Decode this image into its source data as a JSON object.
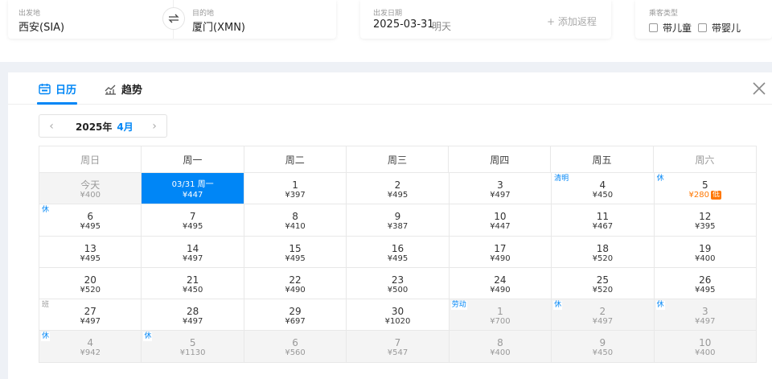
{
  "search": {
    "from_label": "出发地",
    "from_value": "西安(SIA)",
    "to_label": "目的地",
    "to_value": "厦门(XMN)",
    "date_label": "出发日期",
    "date_value": "2025-03-31",
    "day_note": "明天",
    "add_return": "+ 添加返程",
    "pax_label": "乘客类型",
    "pax_child": "带儿童",
    "pax_infant": "带婴儿"
  },
  "tabs": {
    "calendar": "日历",
    "trend": "趋势"
  },
  "month_nav": {
    "prev": "‹",
    "next": "›",
    "year": "2025年",
    "month": "4月"
  },
  "weekdays": [
    "周日",
    "周一",
    "周二",
    "周三",
    "周四",
    "周五",
    "周六"
  ],
  "colors": {
    "accent": "#0086f6",
    "low": "#ff7700"
  },
  "days": [
    {
      "d": "今天",
      "p": "¥400",
      "state": "past"
    },
    {
      "d": "03/31 周一",
      "p": "¥447",
      "state": "sel"
    },
    {
      "d": "1",
      "p": "¥397"
    },
    {
      "d": "2",
      "p": "¥495"
    },
    {
      "d": "3",
      "p": "¥497"
    },
    {
      "d": "4",
      "p": "¥450",
      "tag": "清明"
    },
    {
      "d": "5",
      "p": "¥280",
      "tag": "休",
      "low": "低"
    },
    {
      "d": "6",
      "p": "¥495",
      "tag": "休"
    },
    {
      "d": "7",
      "p": "¥495"
    },
    {
      "d": "8",
      "p": "¥410"
    },
    {
      "d": "9",
      "p": "¥387"
    },
    {
      "d": "10",
      "p": "¥447"
    },
    {
      "d": "11",
      "p": "¥467"
    },
    {
      "d": "12",
      "p": "¥395"
    },
    {
      "d": "13",
      "p": "¥495"
    },
    {
      "d": "14",
      "p": "¥497"
    },
    {
      "d": "15",
      "p": "¥495"
    },
    {
      "d": "16",
      "p": "¥495"
    },
    {
      "d": "17",
      "p": "¥490"
    },
    {
      "d": "18",
      "p": "¥520"
    },
    {
      "d": "19",
      "p": "¥400"
    },
    {
      "d": "20",
      "p": "¥520"
    },
    {
      "d": "21",
      "p": "¥450"
    },
    {
      "d": "22",
      "p": "¥490"
    },
    {
      "d": "23",
      "p": "¥500"
    },
    {
      "d": "24",
      "p": "¥490"
    },
    {
      "d": "25",
      "p": "¥520"
    },
    {
      "d": "26",
      "p": "¥495"
    },
    {
      "d": "27",
      "p": "¥497",
      "tag": "班",
      "tagType": "ban"
    },
    {
      "d": "28",
      "p": "¥497"
    },
    {
      "d": "29",
      "p": "¥697"
    },
    {
      "d": "30",
      "p": "¥1020"
    },
    {
      "d": "1",
      "p": "¥700",
      "state": "next",
      "tag": "劳动"
    },
    {
      "d": "2",
      "p": "¥497",
      "state": "next",
      "tag": "休"
    },
    {
      "d": "3",
      "p": "¥497",
      "state": "next",
      "tag": "休"
    },
    {
      "d": "4",
      "p": "¥942",
      "state": "next",
      "tag": "休"
    },
    {
      "d": "5",
      "p": "¥1130",
      "state": "next",
      "tag": "休"
    },
    {
      "d": "6",
      "p": "¥560",
      "state": "next"
    },
    {
      "d": "7",
      "p": "¥547",
      "state": "next"
    },
    {
      "d": "8",
      "p": "¥400",
      "state": "next"
    },
    {
      "d": "9",
      "p": "¥450",
      "state": "next"
    },
    {
      "d": "10",
      "p": "¥400",
      "state": "next"
    }
  ]
}
